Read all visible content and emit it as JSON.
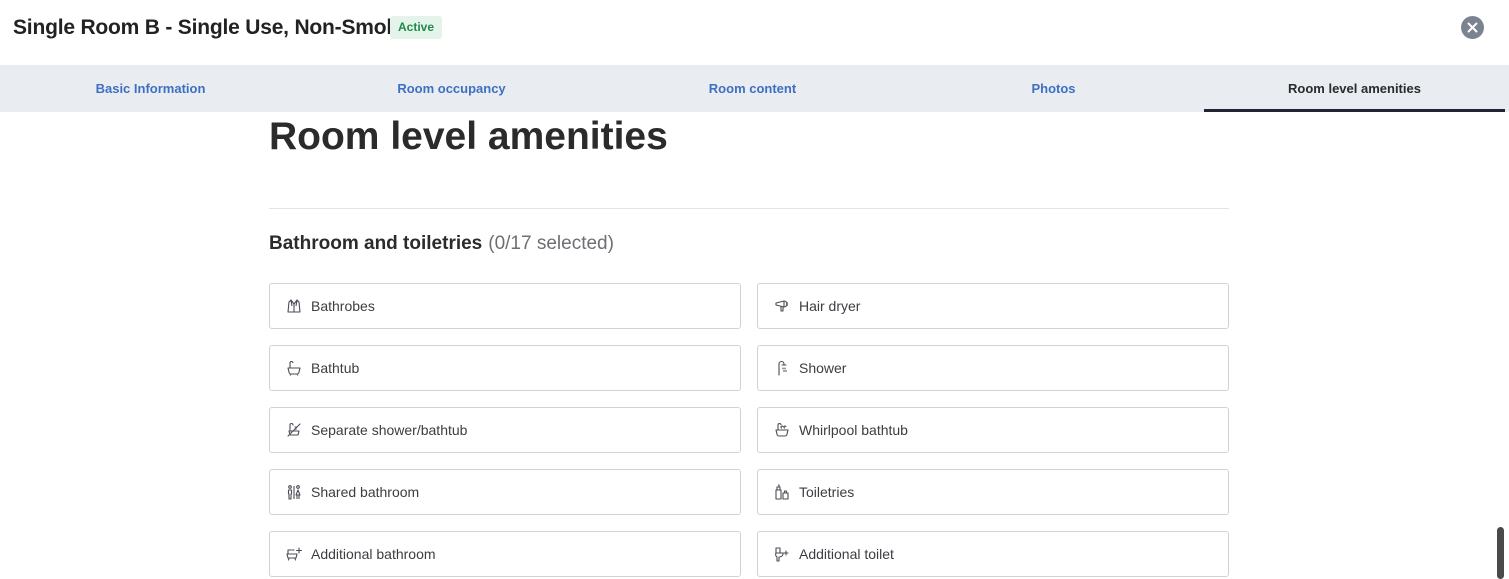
{
  "header": {
    "room_title": "Single Room B - Single Use, Non-Smoking",
    "status": "Active",
    "close_icon": "close-icon"
  },
  "tabs": [
    {
      "label": "Basic Information",
      "active": false
    },
    {
      "label": "Room occupancy",
      "active": false
    },
    {
      "label": "Room content",
      "active": false
    },
    {
      "label": "Photos",
      "active": false
    },
    {
      "label": "Room level amenities",
      "active": true
    }
  ],
  "main": {
    "page_title": "Room level amenities",
    "section": {
      "title": "Bathroom and toiletries",
      "count": "(0/17 selected)",
      "amenities": [
        {
          "label": "Bathrobes",
          "icon": "bathrobe-icon"
        },
        {
          "label": "Hair dryer",
          "icon": "hair-dryer-icon"
        },
        {
          "label": "Bathtub",
          "icon": "bathtub-icon"
        },
        {
          "label": "Shower",
          "icon": "shower-icon"
        },
        {
          "label": "Separate shower/bathtub",
          "icon": "separate-shower-bathtub-icon"
        },
        {
          "label": "Whirlpool bathtub",
          "icon": "whirlpool-bathtub-icon"
        },
        {
          "label": "Shared bathroom",
          "icon": "shared-bathroom-icon"
        },
        {
          "label": "Toiletries",
          "icon": "toiletries-icon"
        },
        {
          "label": "Additional bathroom",
          "icon": "additional-bathroom-icon"
        },
        {
          "label": "Additional toilet",
          "icon": "additional-toilet-icon"
        }
      ]
    }
  },
  "colors": {
    "tab_link": "#3f6fc1",
    "tab_bar": "#e9edf2",
    "active_underline": "#1f2533",
    "badge_bg": "#e5f4ea",
    "badge_text": "#1e8a4c"
  }
}
